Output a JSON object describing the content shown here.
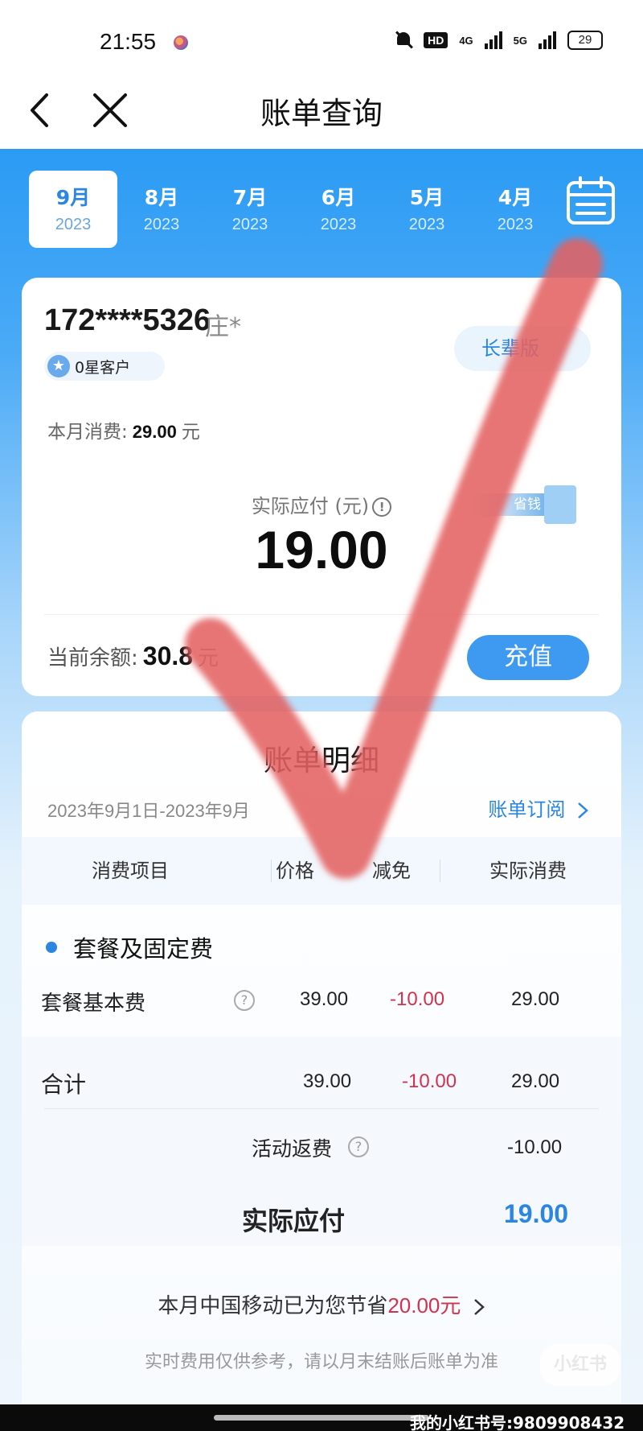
{
  "status_bar": {
    "time": "21:55",
    "signal_1": "4G",
    "signal_2": "5G",
    "hd": "HD",
    "battery": "29"
  },
  "nav": {
    "title": "账单查询"
  },
  "months": [
    {
      "month": "9月",
      "year": "2023",
      "active": true
    },
    {
      "month": "8月",
      "year": "2023",
      "active": false
    },
    {
      "month": "7月",
      "year": "2023",
      "active": false
    },
    {
      "month": "6月",
      "year": "2023",
      "active": false
    },
    {
      "month": "5月",
      "year": "2023",
      "active": false
    },
    {
      "month": "4月",
      "year": "2023",
      "active": false
    }
  ],
  "summary": {
    "phone": "172****5326",
    "name": "庄*",
    "star_badge": "0星客户",
    "elder_button": "长辈版",
    "month_cost_label": "本月消费:",
    "month_cost_value": "29.00",
    "month_cost_unit": "元",
    "pay_label": "实际应付 (元)",
    "pay_amount": "19.00",
    "save_tag": "省钱",
    "balance_label": "当前余额:",
    "balance_value": "30.8",
    "balance_unit": "元",
    "recharge_button": "充值"
  },
  "detail": {
    "title": "账单明细",
    "date_range": "2023年9月1日-2023年9月",
    "subscribe_link": "账单订阅",
    "columns": [
      "消费项目",
      "价格",
      "减免",
      "实际消费"
    ],
    "group": "套餐及固定费",
    "rows": [
      {
        "item": "套餐基本费",
        "price": "39.00",
        "discount": "-10.00",
        "actual": "29.00"
      }
    ],
    "total": {
      "label": "合计",
      "price": "39.00",
      "discount": "-10.00",
      "actual": "29.00"
    },
    "rebate": {
      "label": "活动返费",
      "value": "-10.00"
    },
    "payable": {
      "label": "实际应付",
      "value": "19.00"
    },
    "saved_prefix": "本月中国移动已为您节省",
    "saved_amount": "20.00元",
    "disclaimer": "实时费用仅供参考，请以月末结账后账单为准"
  },
  "watermark": {
    "xhs_logo": "小红书",
    "account": "我的小红书号:9809908432"
  },
  "colors": {
    "accent": "#2a86e0",
    "header_blue": "#2b9bf4",
    "discount_red": "#d0334e",
    "checkmark_red": "#e85a5a"
  },
  "icons": [
    "back-arrow-icon",
    "close-icon",
    "calendar-icon",
    "star-icon",
    "info-icon",
    "question-icon",
    "chevron-right-icon",
    "mute-bell-icon",
    "signal-icon",
    "battery-icon"
  ]
}
